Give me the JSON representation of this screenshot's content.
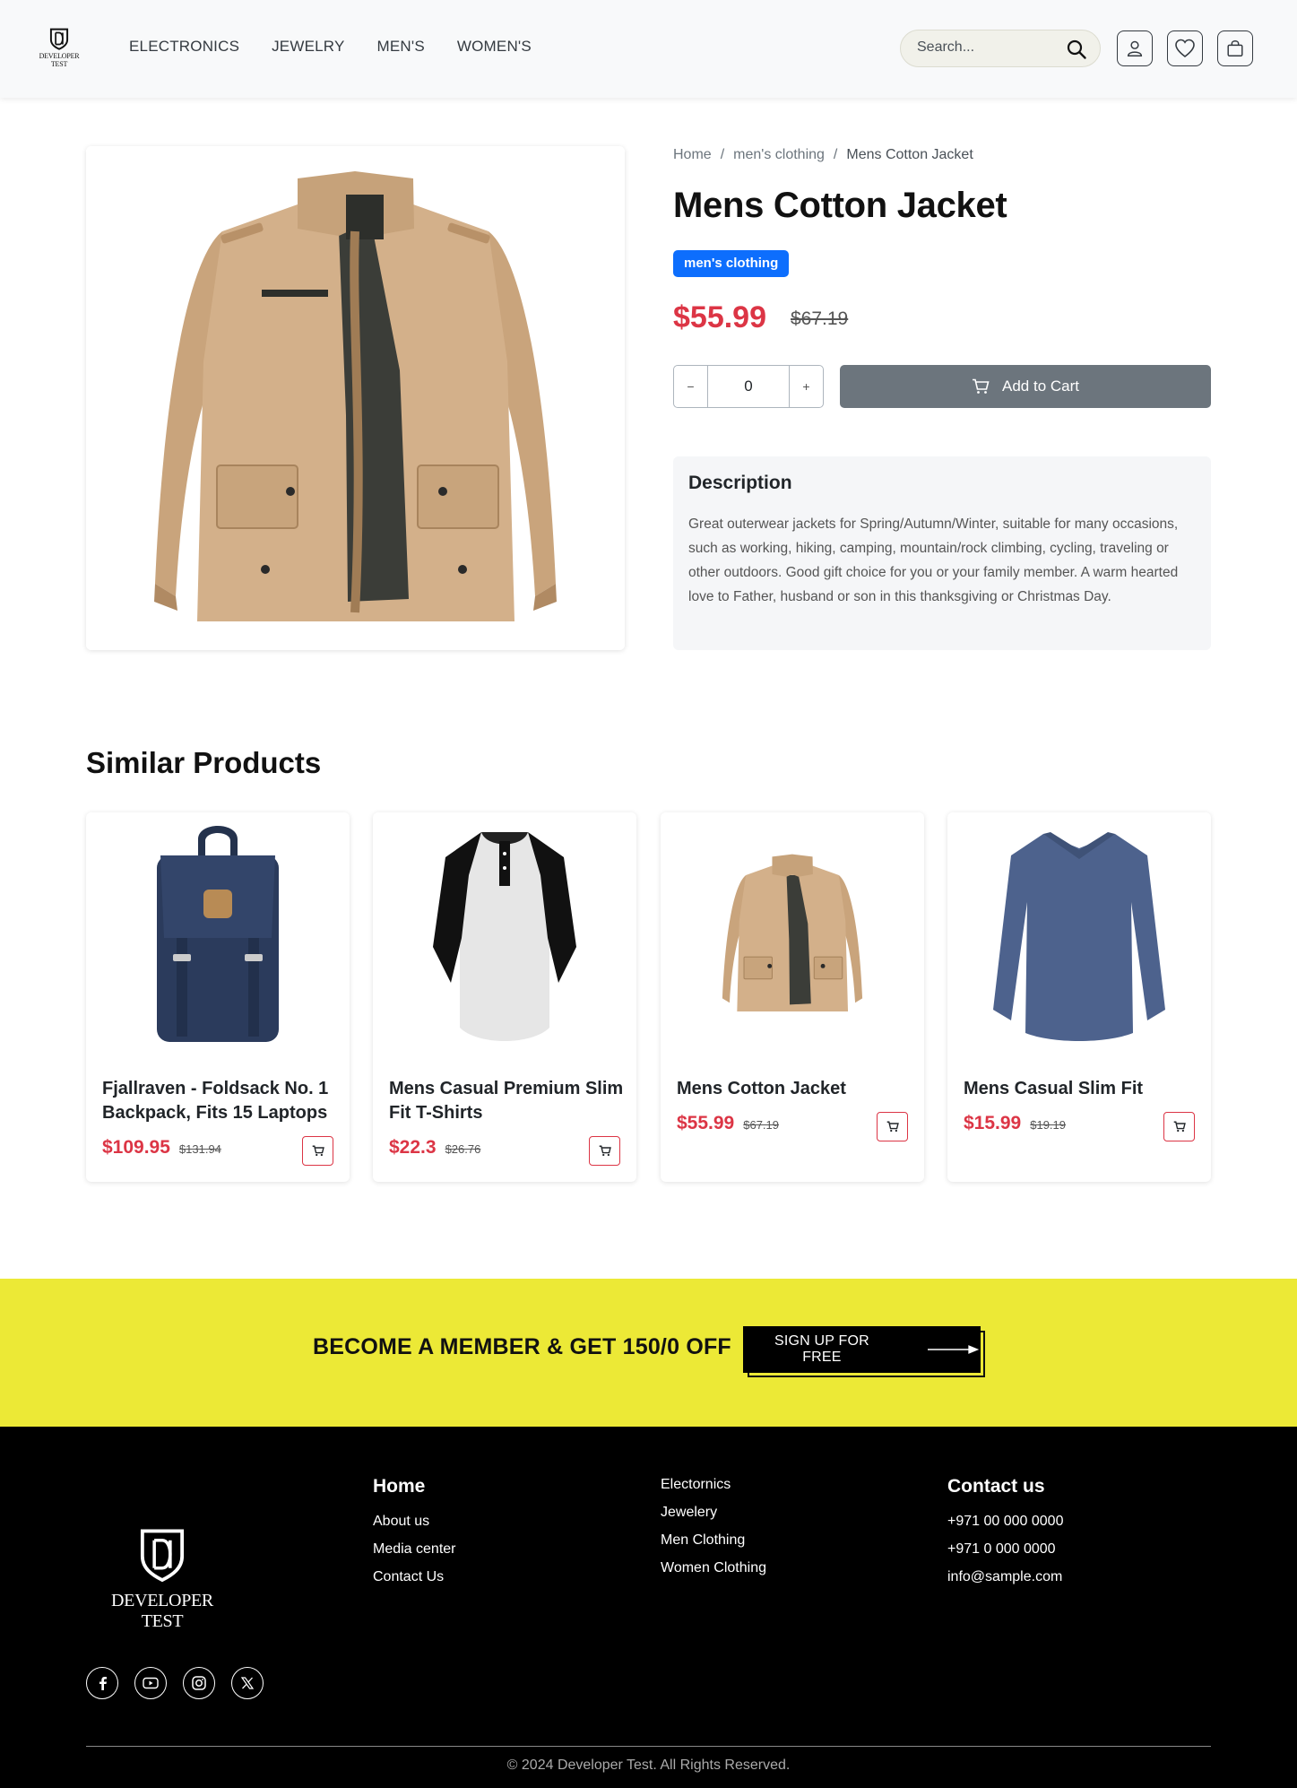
{
  "brand": {
    "name": "DEVELOPER TEST"
  },
  "nav": {
    "items": [
      "ELECTRONICS",
      "JEWELRY",
      "MEN'S",
      "WOMEN'S"
    ]
  },
  "search": {
    "placeholder": "Search..."
  },
  "icons": {
    "search": "search-icon",
    "user": "user-icon",
    "wishlist": "heart-icon",
    "bag": "shopping-bag-icon",
    "cart": "cart-icon"
  },
  "product": {
    "breadcrumb": [
      "Home",
      "men's clothing",
      "Mens Cotton Jacket"
    ],
    "title": "Mens Cotton Jacket",
    "category": "men's clothing",
    "price": "$55.99",
    "old_price": "$67.19",
    "quantity": "0",
    "qty_minus": "−",
    "qty_plus": "+",
    "add_to_cart": "Add to Cart",
    "description_title": "Description",
    "description": "Great outerwear jackets for Spring/Autumn/Winter, suitable for many occasions, such as working, hiking, camping, mountain/rock climbing, cycling, traveling or other outdoors. Good gift choice for you or your family member. A warm hearted love to Father, husband or son in this thanksgiving or Christmas Day."
  },
  "similar": {
    "title": "Similar Products",
    "items": [
      {
        "title": "Fjallraven - Foldsack No. 1 Backpack, Fits 15 Laptops",
        "price": "$109.95",
        "old_price": "$131.94",
        "image": "backpack"
      },
      {
        "title": "Mens Casual Premium Slim Fit T-Shirts",
        "price": "$22.3",
        "old_price": "$26.76",
        "image": "raglan-tshirt"
      },
      {
        "title": "Mens Cotton Jacket",
        "price": "$55.99",
        "old_price": "$67.19",
        "image": "cotton-jacket"
      },
      {
        "title": "Mens Casual Slim Fit",
        "price": "$15.99",
        "old_price": "$19.19",
        "image": "blue-longsleeve"
      }
    ]
  },
  "banner": {
    "text": "BECOME A MEMBER & GET 150/0 OFF",
    "button": "SIGN UP FOR FREE"
  },
  "footer": {
    "col1": {
      "head": "Home",
      "links": [
        "About us",
        "Media center",
        "Contact Us"
      ]
    },
    "col2": {
      "links": [
        "Electornics",
        "Jewelery",
        "Men Clothing",
        "Women Clothing"
      ]
    },
    "col3": {
      "head": "Contact us",
      "links": [
        "+971 00 000 0000",
        "+971 0 000 0000",
        "info@sample.com"
      ]
    },
    "social": [
      "facebook-icon",
      "youtube-icon",
      "instagram-icon",
      "x-icon"
    ],
    "copyright": "© 2024 Developer Test. All Rights Reserved."
  },
  "colors": {
    "price": "#dc3545",
    "badge": "#0d6efd",
    "banner": "#ece936",
    "cart_button": "#6c757d"
  }
}
